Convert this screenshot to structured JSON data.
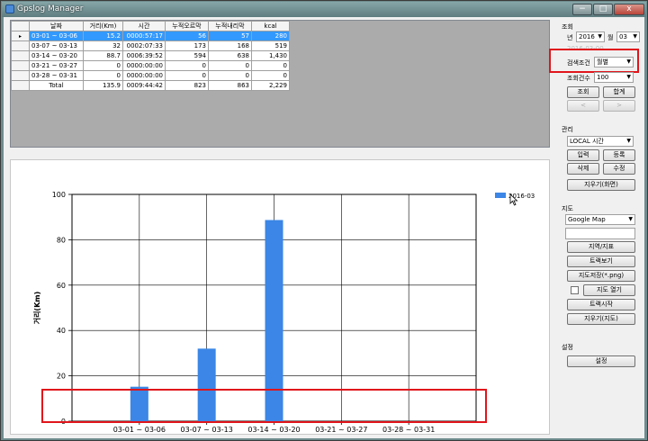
{
  "window": {
    "title": "Gpslog Manager",
    "minimize": "−",
    "maximize": "□",
    "close": "x"
  },
  "grid": {
    "headers": [
      "날짜",
      "거리(Km)",
      "시간",
      "누적오르막",
      "누적내리막",
      "kcal"
    ],
    "row_marker": "▸",
    "rows": [
      [
        "03-01 ~ 03-06",
        "15.2",
        "0000:57:17",
        "56",
        "57",
        "280"
      ],
      [
        "03-07 ~ 03-13",
        "32",
        "0002:07:33",
        "173",
        "168",
        "519"
      ],
      [
        "03-14 ~ 03-20",
        "88.7",
        "0006:39:52",
        "594",
        "638",
        "1,430"
      ],
      [
        "03-21 ~ 03-27",
        "0",
        "0000:00:00",
        "0",
        "0",
        "0"
      ],
      [
        "03-28 ~ 03-31",
        "0",
        "0000:00:00",
        "0",
        "0",
        "0"
      ],
      [
        "Total",
        "135.9",
        "0009:44:42",
        "823",
        "863",
        "2,229"
      ]
    ]
  },
  "chart_data": {
    "type": "bar",
    "categories": [
      "03-01 ~ 03-06",
      "03-07 ~ 03-13",
      "03-14 ~ 03-20",
      "03-21 ~ 03-27",
      "03-28 ~ 03-31"
    ],
    "series": [
      {
        "name": "2016-03",
        "values": [
          15.2,
          32,
          88.7,
          0,
          0
        ],
        "color": "#3b86e6"
      }
    ],
    "ylabel": "거리(Km)",
    "ylim": [
      0,
      100
    ],
    "yticks": [
      0,
      20,
      40,
      60,
      80,
      100
    ],
    "grid": true,
    "legend": "top-right"
  },
  "side": {
    "query_group": "조회",
    "year_label": "년",
    "year": "2016",
    "month_label": "월",
    "month": "03",
    "hidden_row": "2016-03-00",
    "criteria_label": "검색조건",
    "criteria": "월별",
    "cond_label": "조회건수",
    "cond_value": "100",
    "search_btn": "조회",
    "sum_btn": "합계",
    "prev_btn": "<",
    "next_btn": ">",
    "manage_group": "관리",
    "time_mode": "LOCAL 시간",
    "input_btn": "입력",
    "register_btn": "등록",
    "delete_btn": "삭제",
    "edit_btn": "수정",
    "clear_screen_btn": "지우기(화면)",
    "map_group": "지도",
    "map_provider": "Google Map",
    "region_btn": "지역/지표",
    "track_view_btn": "트랙보기",
    "save_map_btn": "지도저장(*.png)",
    "open_map_btn": "지도 열기",
    "track_start_btn": "트랙시작",
    "clear_map_btn": "지우기(지도)",
    "settings_group": "설정",
    "settings_btn": "설정"
  },
  "colors": {
    "highlight": "#e0151b",
    "selection": "#3399ff",
    "bar": "#3b86e6"
  }
}
